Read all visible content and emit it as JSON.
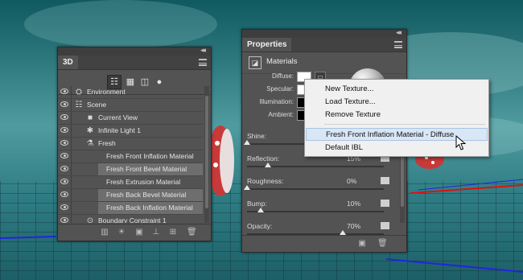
{
  "panel_3d": {
    "tab": "3D",
    "rows": [
      {
        "label": "Environment",
        "icon": "environment-icon",
        "indent": 0,
        "selected": false
      },
      {
        "label": "Scene",
        "icon": "scene-icon",
        "indent": 0,
        "selected": false
      },
      {
        "label": "Current View",
        "icon": "camera-icon",
        "indent": 1,
        "selected": false
      },
      {
        "label": "Infinite Light 1",
        "icon": "light-icon",
        "indent": 1,
        "selected": false
      },
      {
        "label": "Fresh",
        "icon": "mesh-icon",
        "indent": 1,
        "selected": false
      },
      {
        "label": "Fresh Front Inflation Material",
        "icon": "",
        "indent": 2,
        "selected": false
      },
      {
        "label": "Fresh Front Bevel Material",
        "icon": "",
        "indent": 2,
        "selected": true
      },
      {
        "label": "Fresh Extrusion Material",
        "icon": "",
        "indent": 2,
        "selected": false
      },
      {
        "label": "Fresh Back Bevel Material",
        "icon": "",
        "indent": 2,
        "selected": true
      },
      {
        "label": "Fresh Back Inflation Material",
        "icon": "",
        "indent": 2,
        "selected": true
      },
      {
        "label": "Boundary Constraint 1",
        "icon": "constraint-icon",
        "indent": 1,
        "selected": false
      }
    ]
  },
  "properties": {
    "tab": "Properties",
    "section": "Materials",
    "swatch_rows": [
      {
        "label": "Diffuse:",
        "color": "#ffffff"
      },
      {
        "label": "Specular:",
        "color": "#ffffff"
      },
      {
        "label": "Illumination:",
        "color": "#000000"
      },
      {
        "label": "Ambient:",
        "color": "#000000"
      }
    ],
    "sliders": [
      {
        "label": "Shine:",
        "value": "",
        "level": 0.0
      },
      {
        "label": "Reflection:",
        "value": "15%",
        "level": 0.15
      },
      {
        "label": "Roughness:",
        "value": "0%",
        "level": 0.0
      },
      {
        "label": "Bump:",
        "value": "10%",
        "level": 0.1
      },
      {
        "label": "Opacity:",
        "value": "70%",
        "level": 0.7
      }
    ]
  },
  "context_menu": {
    "items": [
      {
        "label": "New Texture...",
        "hover": false
      },
      {
        "label": "Load Texture...",
        "hover": false
      },
      {
        "label": "Remove Texture",
        "hover": false
      },
      {
        "label": "Fresh Front Inflation Material - Diffuse",
        "hover": true
      },
      {
        "label": "Default IBL",
        "hover": false
      }
    ]
  }
}
